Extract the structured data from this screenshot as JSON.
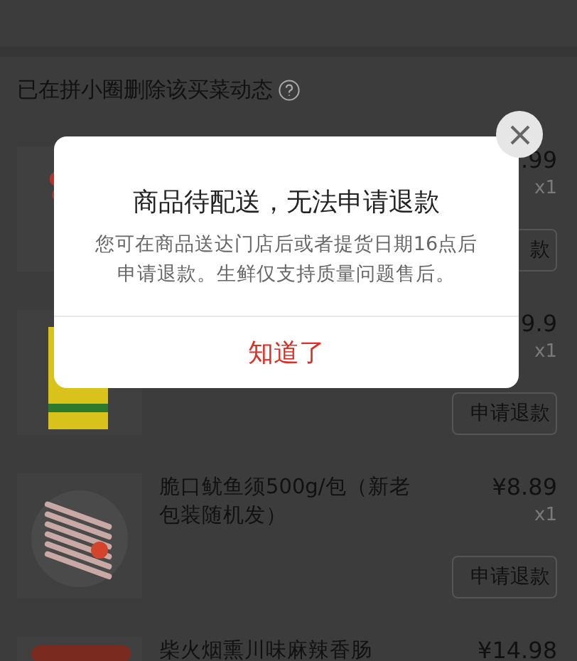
{
  "section": {
    "title": "已在拼小圈删除该买菜动态"
  },
  "items": [
    {
      "kind": "picture",
      "price": ".99",
      "qty": "x1",
      "button": "款"
    },
    {
      "kind": "picture",
      "price": "9.9",
      "qty": "x1",
      "button": "申请退款"
    },
    {
      "kind": "picture",
      "title": "脆口鱿鱼须500g/包（新老包装随机发）",
      "price": "¥8.89",
      "qty": "x1",
      "button": "申请退款"
    },
    {
      "kind": "picture",
      "title": "柴火烟熏川味麻辣香肠",
      "price": "¥14.98"
    }
  ],
  "dialog": {
    "title": "商品待配送，无法申请退款",
    "message": "您可在商品送达门店后或者提货日期16点后申请退款。生鲜仅支持质量问题售后。",
    "button": "知道了"
  }
}
